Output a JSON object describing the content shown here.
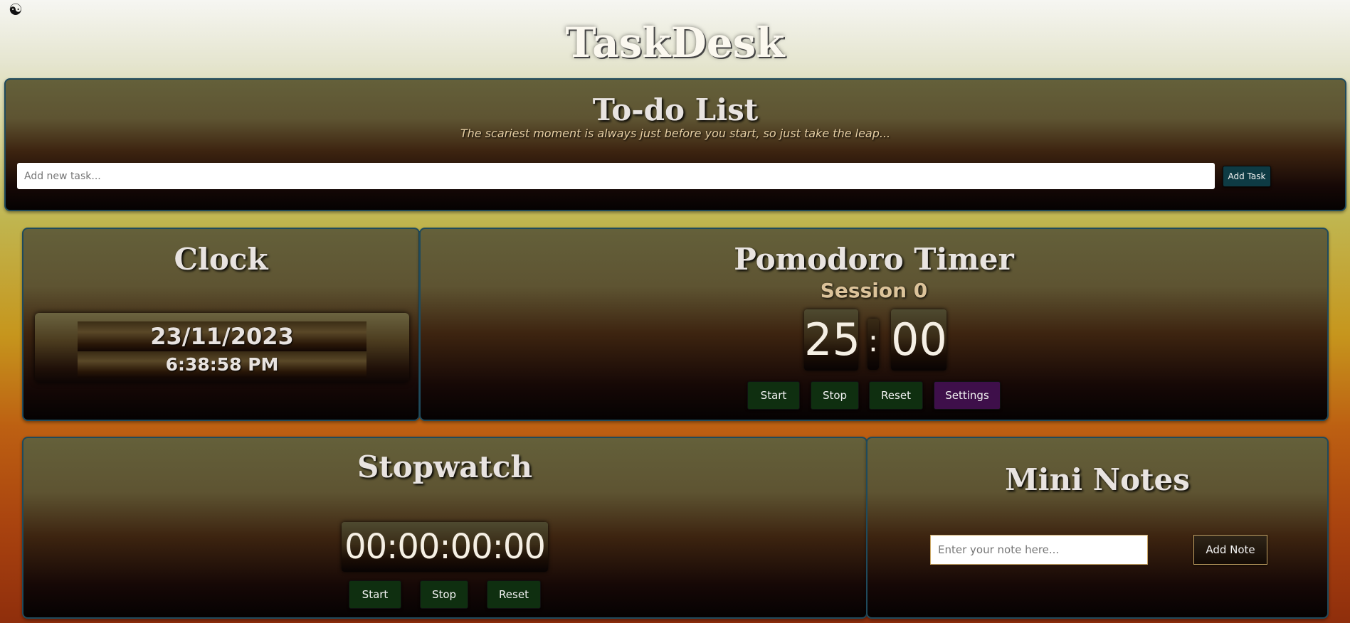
{
  "header": {
    "title": "TaskDesk",
    "theme_icon": "☯"
  },
  "todo": {
    "title": "To-do List",
    "quote": "The scariest moment is always just before you start, so just take the leap...",
    "input_placeholder": "Add new task...",
    "add_label": "Add Task"
  },
  "clock": {
    "title": "Clock",
    "date": "23/11/2023",
    "time": "6:38:58 PM"
  },
  "pomodoro": {
    "title": "Pomodoro Timer",
    "session": "Session 0",
    "minutes": "25",
    "separator": ":",
    "seconds": "00",
    "buttons": {
      "start": "Start",
      "stop": "Stop",
      "reset": "Reset",
      "settings": "Settings"
    }
  },
  "stopwatch": {
    "title": "Stopwatch",
    "display": "00:00:00:00",
    "buttons": {
      "start": "Start",
      "stop": "Stop",
      "reset": "Reset"
    }
  },
  "notes": {
    "title": "Mini Notes",
    "input_placeholder": "Enter your note here...",
    "add_label": "Add Note"
  },
  "colors": {
    "panel_border": "#1f4a5c",
    "button_green": "#0f2f10",
    "button_purple": "#3e0f4a",
    "add_task_button": "#0e3b44",
    "text_light": "#e8e3e0",
    "quote_color": "#e7cfa4"
  }
}
